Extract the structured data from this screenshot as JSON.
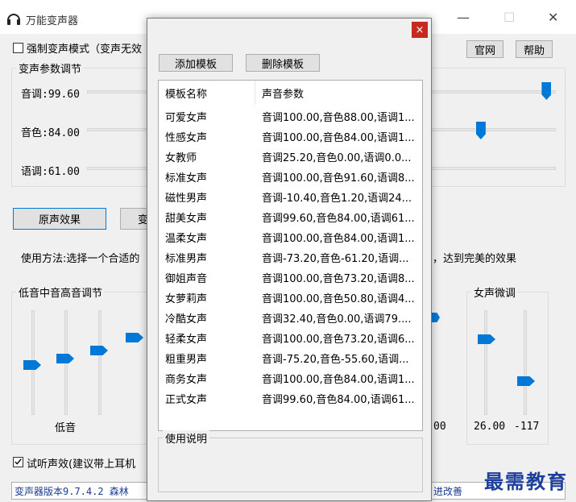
{
  "app": {
    "title": "万能变声器",
    "minimize": "—",
    "maximize": "☐",
    "close": "✕"
  },
  "options": {
    "force_mode_label": "强制变声模式（变声无效",
    "official_site": "官网",
    "help": "帮助"
  },
  "params": {
    "group_label": "变声参数调节",
    "pitch_label": "音调:99.60",
    "timbre_label": "音色:84.00",
    "speed_label": "语调:61.00",
    "pitch_fraction": 0.98,
    "timbre_fraction": 0.84,
    "speed_fraction": 0.61
  },
  "effects": {
    "original_button": "原声效果",
    "second_button_fragment": "变"
  },
  "usage": {
    "left": "使用方法:选择一个合适的",
    "right": "，达到完美的效果"
  },
  "eq": {
    "group_label": "低音中音高音调节",
    "bass_label": "低音",
    "right_value": "00"
  },
  "female_tune": {
    "group_label": "女声微调",
    "value_left": "26.00",
    "value_right": "-117"
  },
  "listen": {
    "label": "试听声效(建议带上耳机"
  },
  "status": {
    "left": "变声器版本9.7.4.2  森林",
    "right": "进改善"
  },
  "dialog": {
    "close": "×",
    "add_template": "添加模板",
    "delete_template": "删除模板",
    "col_name": "模板名称",
    "col_params": "声音参数",
    "usage_label": "使用说明",
    "templates": [
      {
        "name": "可爱女声",
        "params": "音调100.00,音色88.00,语调1..."
      },
      {
        "name": "性感女声",
        "params": "音调100.00,音色84.00,语调1..."
      },
      {
        "name": "女教师",
        "params": "音调25.20,音色0.00,语调0.0..."
      },
      {
        "name": "标准女声",
        "params": "音调100.00,音色91.60,语调8..."
      },
      {
        "name": "磁性男声",
        "params": "音调-10.40,音色1.20,语调24..."
      },
      {
        "name": "甜美女声",
        "params": "音调99.60,音色84.00,语调61..."
      },
      {
        "name": "温柔女声",
        "params": "音调100.00,音色84.00,语调1..."
      },
      {
        "name": "标准男声",
        "params": "音调-73.20,音色-61.20,语调..."
      },
      {
        "name": "御姐声音",
        "params": "音调100.00,音色73.20,语调8..."
      },
      {
        "name": "女萝莉声",
        "params": "音调100.00,音色50.80,语调4..."
      },
      {
        "name": "冷酷女声",
        "params": "音调32.40,音色0.00,语调79...."
      },
      {
        "name": "轻柔女声",
        "params": "音调100.00,音色73.20,语调6..."
      },
      {
        "name": "粗重男声",
        "params": "音调-75.20,音色-55.60,语调..."
      },
      {
        "name": "商务女声",
        "params": "音调100.00,音色84.00,语调1..."
      },
      {
        "name": "正式女声",
        "params": "音调99.60,音色84.00,语调61..."
      }
    ]
  },
  "watermark": "最需教育",
  "colors": {
    "accent": "#0078d7",
    "close_red": "#c42b1c",
    "watermark": "#1c3f9e"
  }
}
